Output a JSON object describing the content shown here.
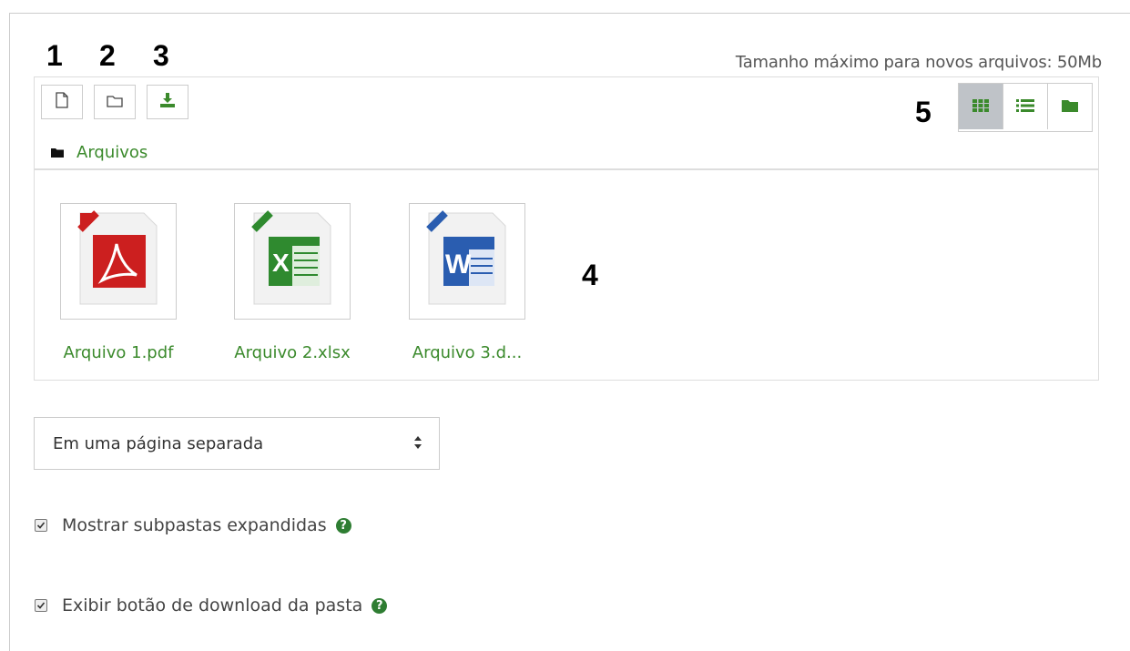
{
  "annotations": {
    "n1": "1",
    "n2": "2",
    "n3": "3",
    "n4": "4",
    "n5": "5"
  },
  "header": {
    "max_size": "Tamanho máximo para novos arquivos: 50Mb"
  },
  "toolbar": {
    "buttons": [
      {
        "icon": "new-file-icon"
      },
      {
        "icon": "new-folder-icon"
      },
      {
        "icon": "download-icon"
      }
    ]
  },
  "view_modes": [
    {
      "icon": "grid-icon",
      "active": true
    },
    {
      "icon": "list-icon",
      "active": false
    },
    {
      "icon": "folder-tree-icon",
      "active": false
    }
  ],
  "breadcrumb": {
    "icon": "folder-icon",
    "label": "Arquivos"
  },
  "files": [
    {
      "name": "Arquivo 1.pdf",
      "type": "pdf",
      "color": "#cc1f1f"
    },
    {
      "name": "Arquivo 2.xlsx",
      "type": "xlsx",
      "color": "#2f8a2f"
    },
    {
      "name": "Arquivo 3.d...",
      "type": "docx",
      "color": "#2a5db0"
    }
  ],
  "display_select": {
    "value": "Em uma página separada"
  },
  "options": [
    {
      "label": "Mostrar subpastas expandidas",
      "checked": true,
      "help": "?"
    },
    {
      "label": "Exibir botão de download da pasta",
      "checked": true,
      "help": "?"
    }
  ],
  "colors": {
    "accent": "#3b8a2c",
    "active_view": "#bfc3c8"
  }
}
